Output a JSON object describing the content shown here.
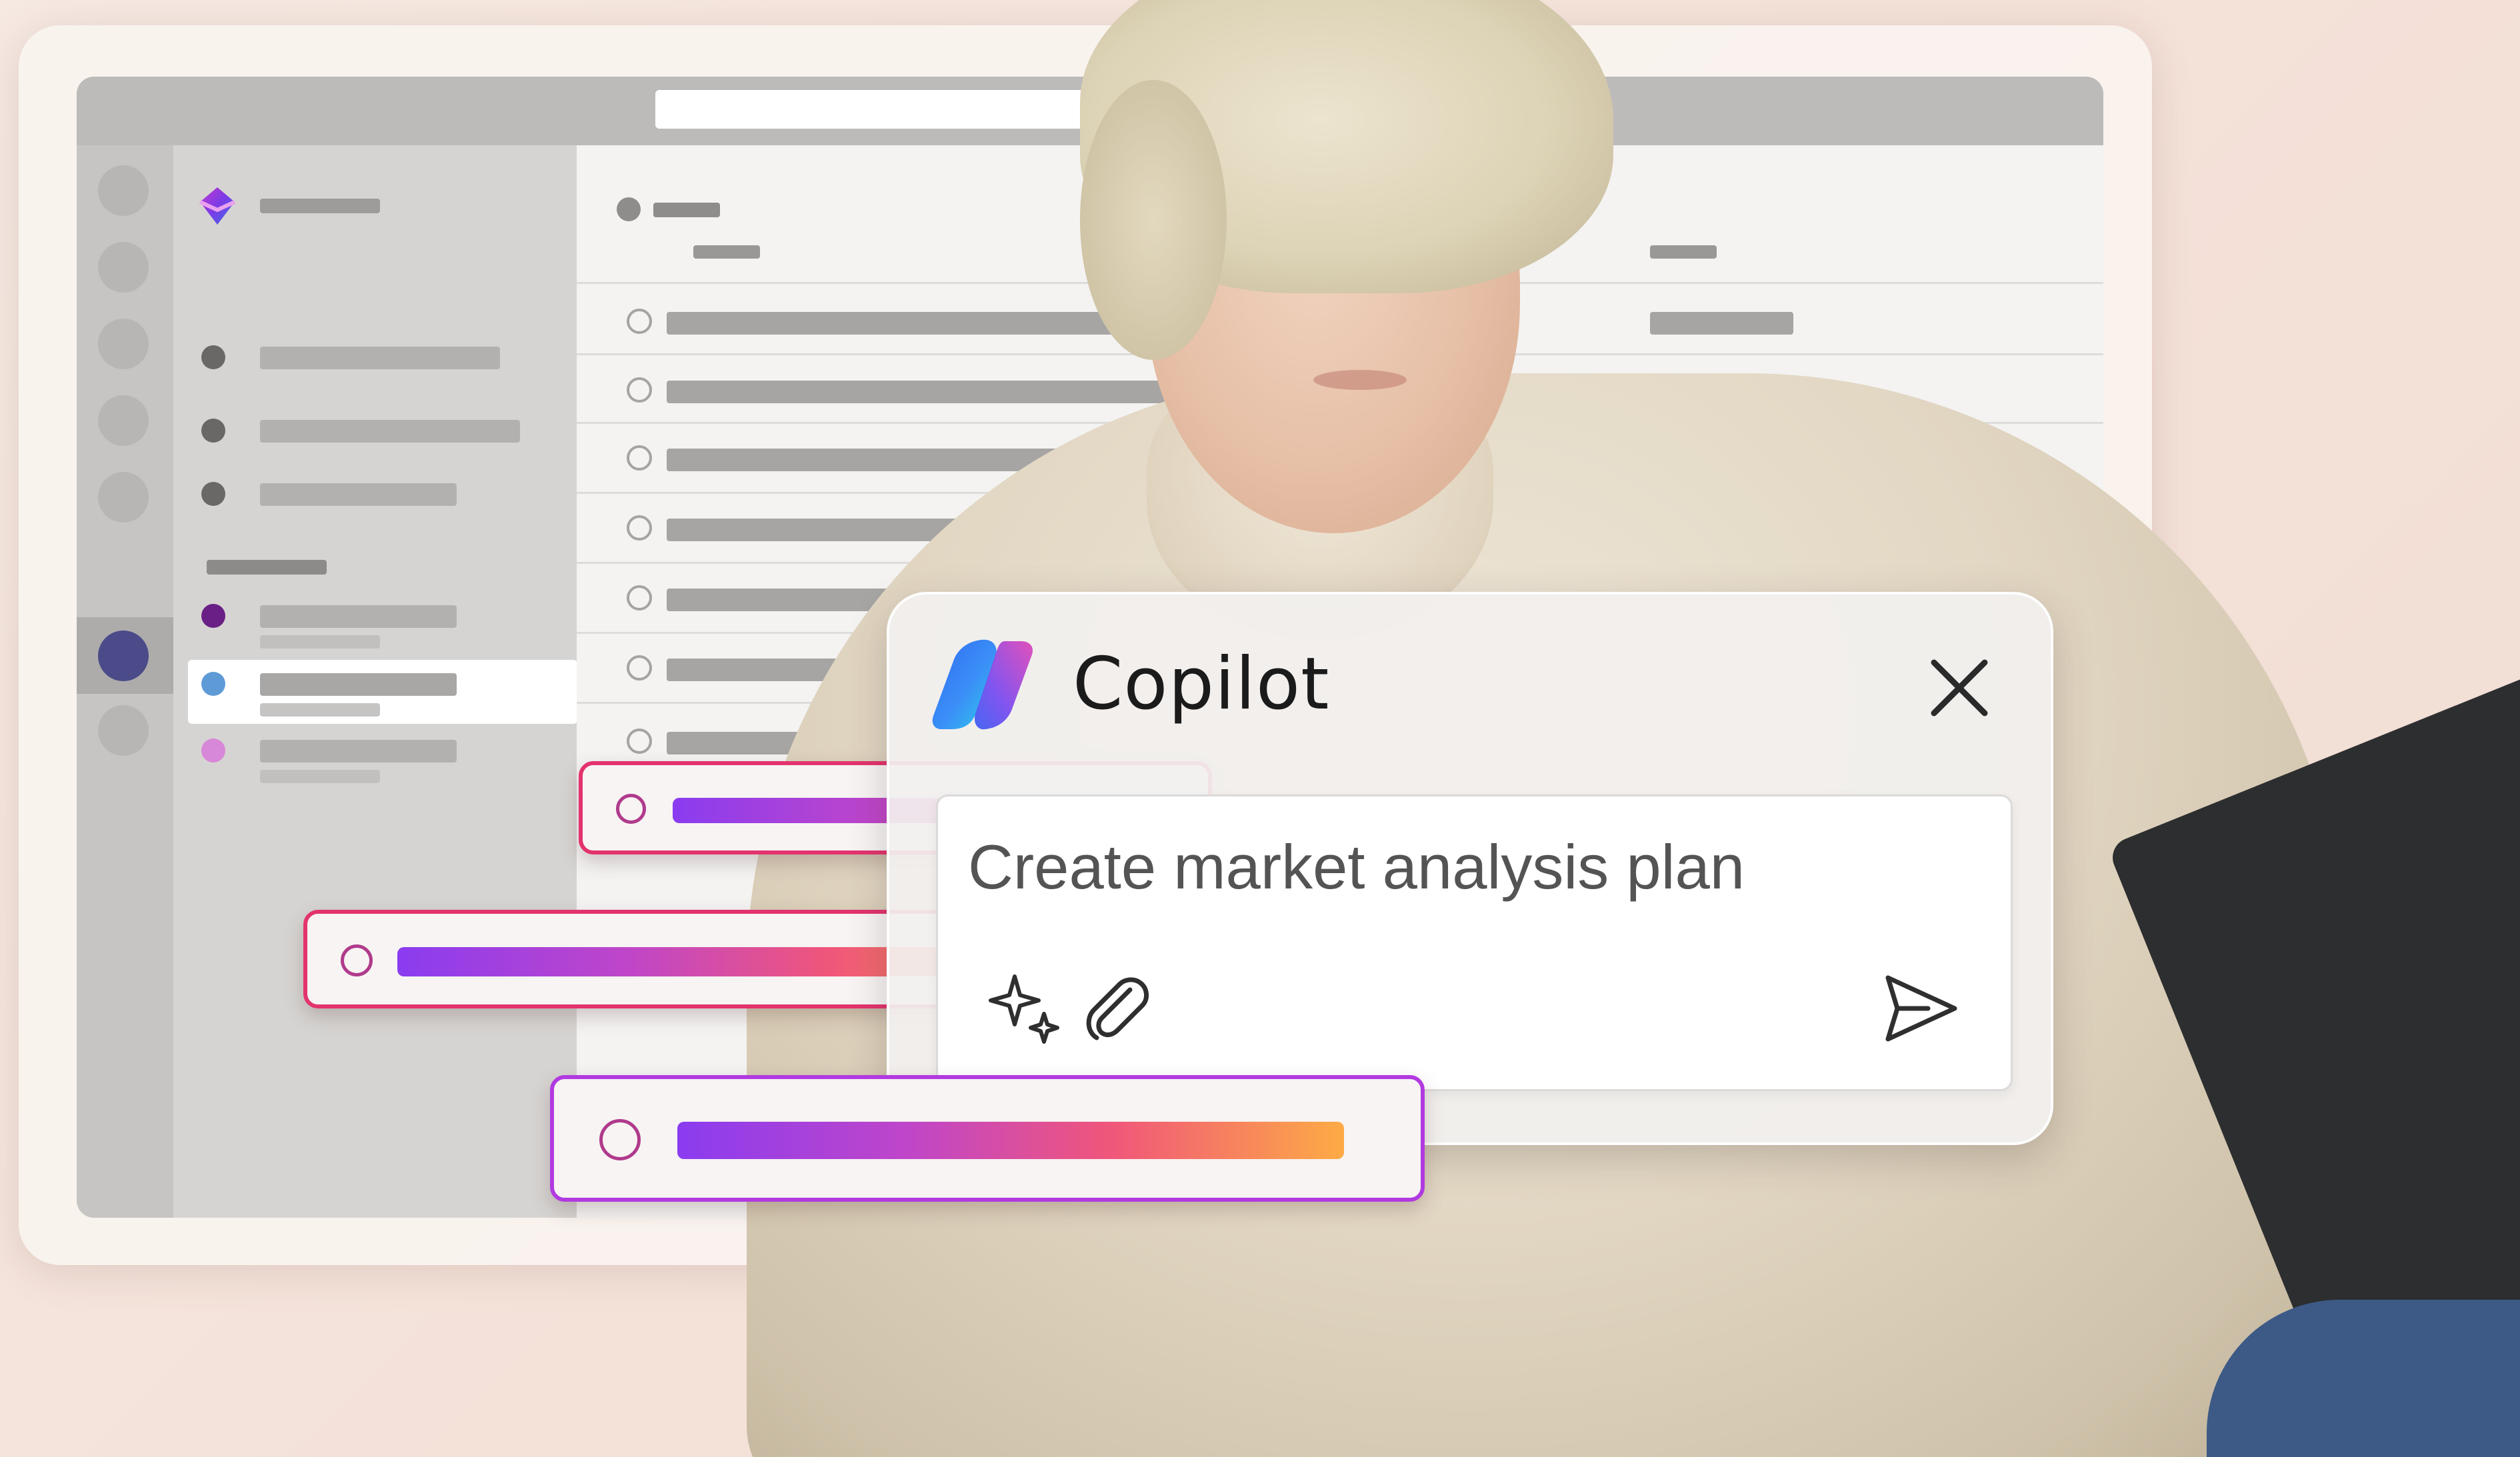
{
  "copilot": {
    "title": "Copilot",
    "prompt": "Create market analysis plan"
  },
  "icons": {
    "app_logo": "copilot-logo-icon",
    "close": "close-icon",
    "prompt_suggestions": "sparkle-icon",
    "attach": "paperclip-icon",
    "send": "send-icon"
  },
  "colors": {
    "accent_gradient": [
      "#8a3cf0",
      "#c046c8",
      "#f0567a",
      "#fdab45"
    ],
    "pill_border_pink": "#e3336e",
    "pill_border_violet": "#b13ae0",
    "rail_active": "#4a4b88",
    "nav_dot_purple": "#6a1f86",
    "nav_dot_blue": "#5e9ad6",
    "nav_dot_pink": "#d888d8"
  }
}
